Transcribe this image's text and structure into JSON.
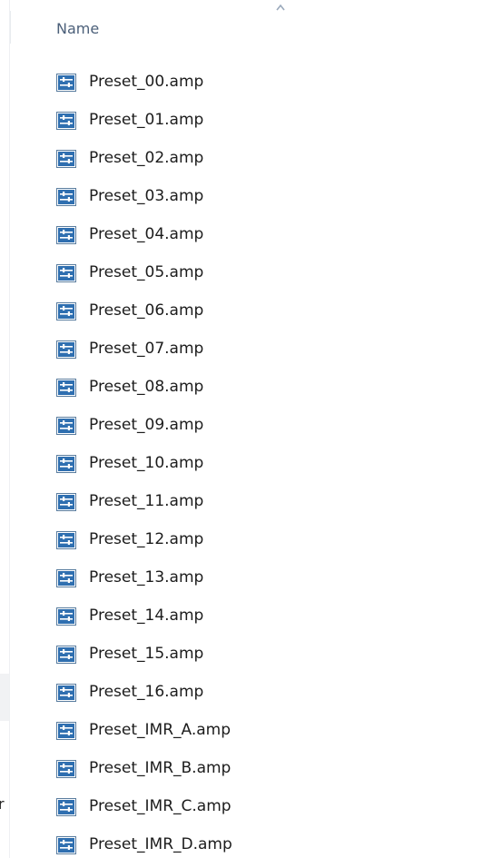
{
  "header": {
    "name_label": "Name"
  },
  "nav": {
    "partial_text": "r"
  },
  "icons": {
    "sort": "sort-ascending-icon",
    "file": "settings-file-icon"
  },
  "colors": {
    "icon_blue": "#2f6fb0",
    "icon_frame": "#5a7d9f",
    "header_text": "#4c607a"
  },
  "files": [
    "Preset_00.amp",
    "Preset_01.amp",
    "Preset_02.amp",
    "Preset_03.amp",
    "Preset_04.amp",
    "Preset_05.amp",
    "Preset_06.amp",
    "Preset_07.amp",
    "Preset_08.amp",
    "Preset_09.amp",
    "Preset_10.amp",
    "Preset_11.amp",
    "Preset_12.amp",
    "Preset_13.amp",
    "Preset_14.amp",
    "Preset_15.amp",
    "Preset_16.amp",
    "Preset_IMR_A.amp",
    "Preset_IMR_B.amp",
    "Preset_IMR_C.amp",
    "Preset_IMR_D.amp"
  ]
}
